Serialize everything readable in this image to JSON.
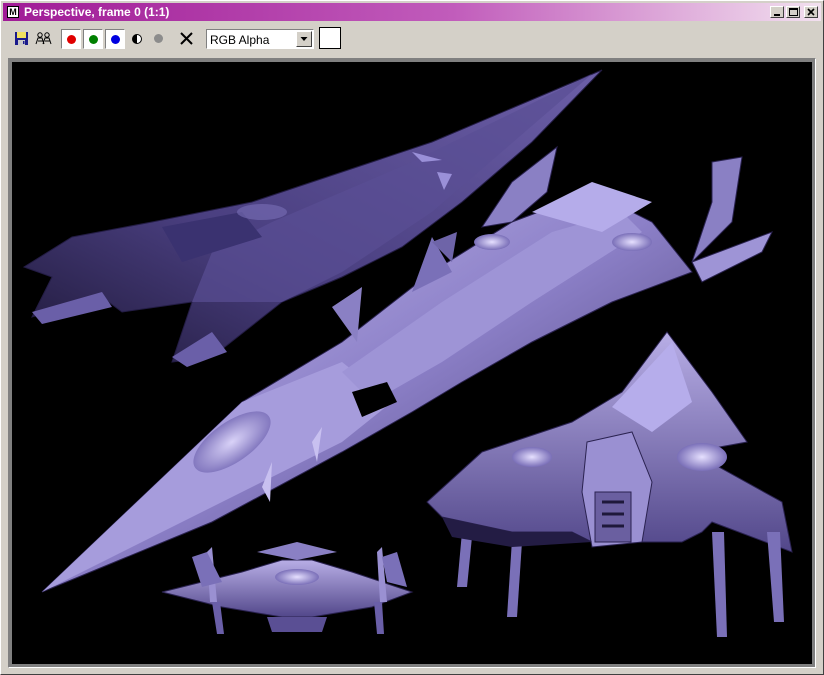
{
  "window": {
    "title": "Perspective, frame 0 (1:1)",
    "icon_letter": "M"
  },
  "title_buttons": [
    {
      "name": "minimize-button",
      "icon": "minimize-icon"
    },
    {
      "name": "maximize-button",
      "icon": "maximize-icon"
    },
    {
      "name": "close-button",
      "icon": "close-icon"
    }
  ],
  "toolbar": {
    "tools": [
      {
        "name": "save-image-button",
        "icon": "floppy-disk-icon"
      },
      {
        "name": "clone-window-button",
        "icon": "clone-window-icon"
      },
      {
        "name": "red-channel-toggle",
        "icon": "red-dot-icon",
        "color": "#e00000",
        "pressed": true
      },
      {
        "name": "green-channel-toggle",
        "icon": "green-dot-icon",
        "color": "#008000",
        "pressed": true
      },
      {
        "name": "blue-channel-toggle",
        "icon": "blue-dot-icon",
        "color": "#0000e0",
        "pressed": true
      },
      {
        "name": "monochrome-toggle",
        "icon": "half-circle-icon"
      },
      {
        "name": "alpha-channel-toggle",
        "icon": "gray-dot-icon",
        "color": "#8c8c8c"
      },
      {
        "name": "clear-button",
        "icon": "x-icon"
      }
    ],
    "channel_select": {
      "value": "RGB Alpha"
    },
    "color_swatch": "#ffffff"
  },
  "viewport": {
    "background": "#000000",
    "content": "rendered spaceship image",
    "ship_color": "#8a7fc4"
  }
}
